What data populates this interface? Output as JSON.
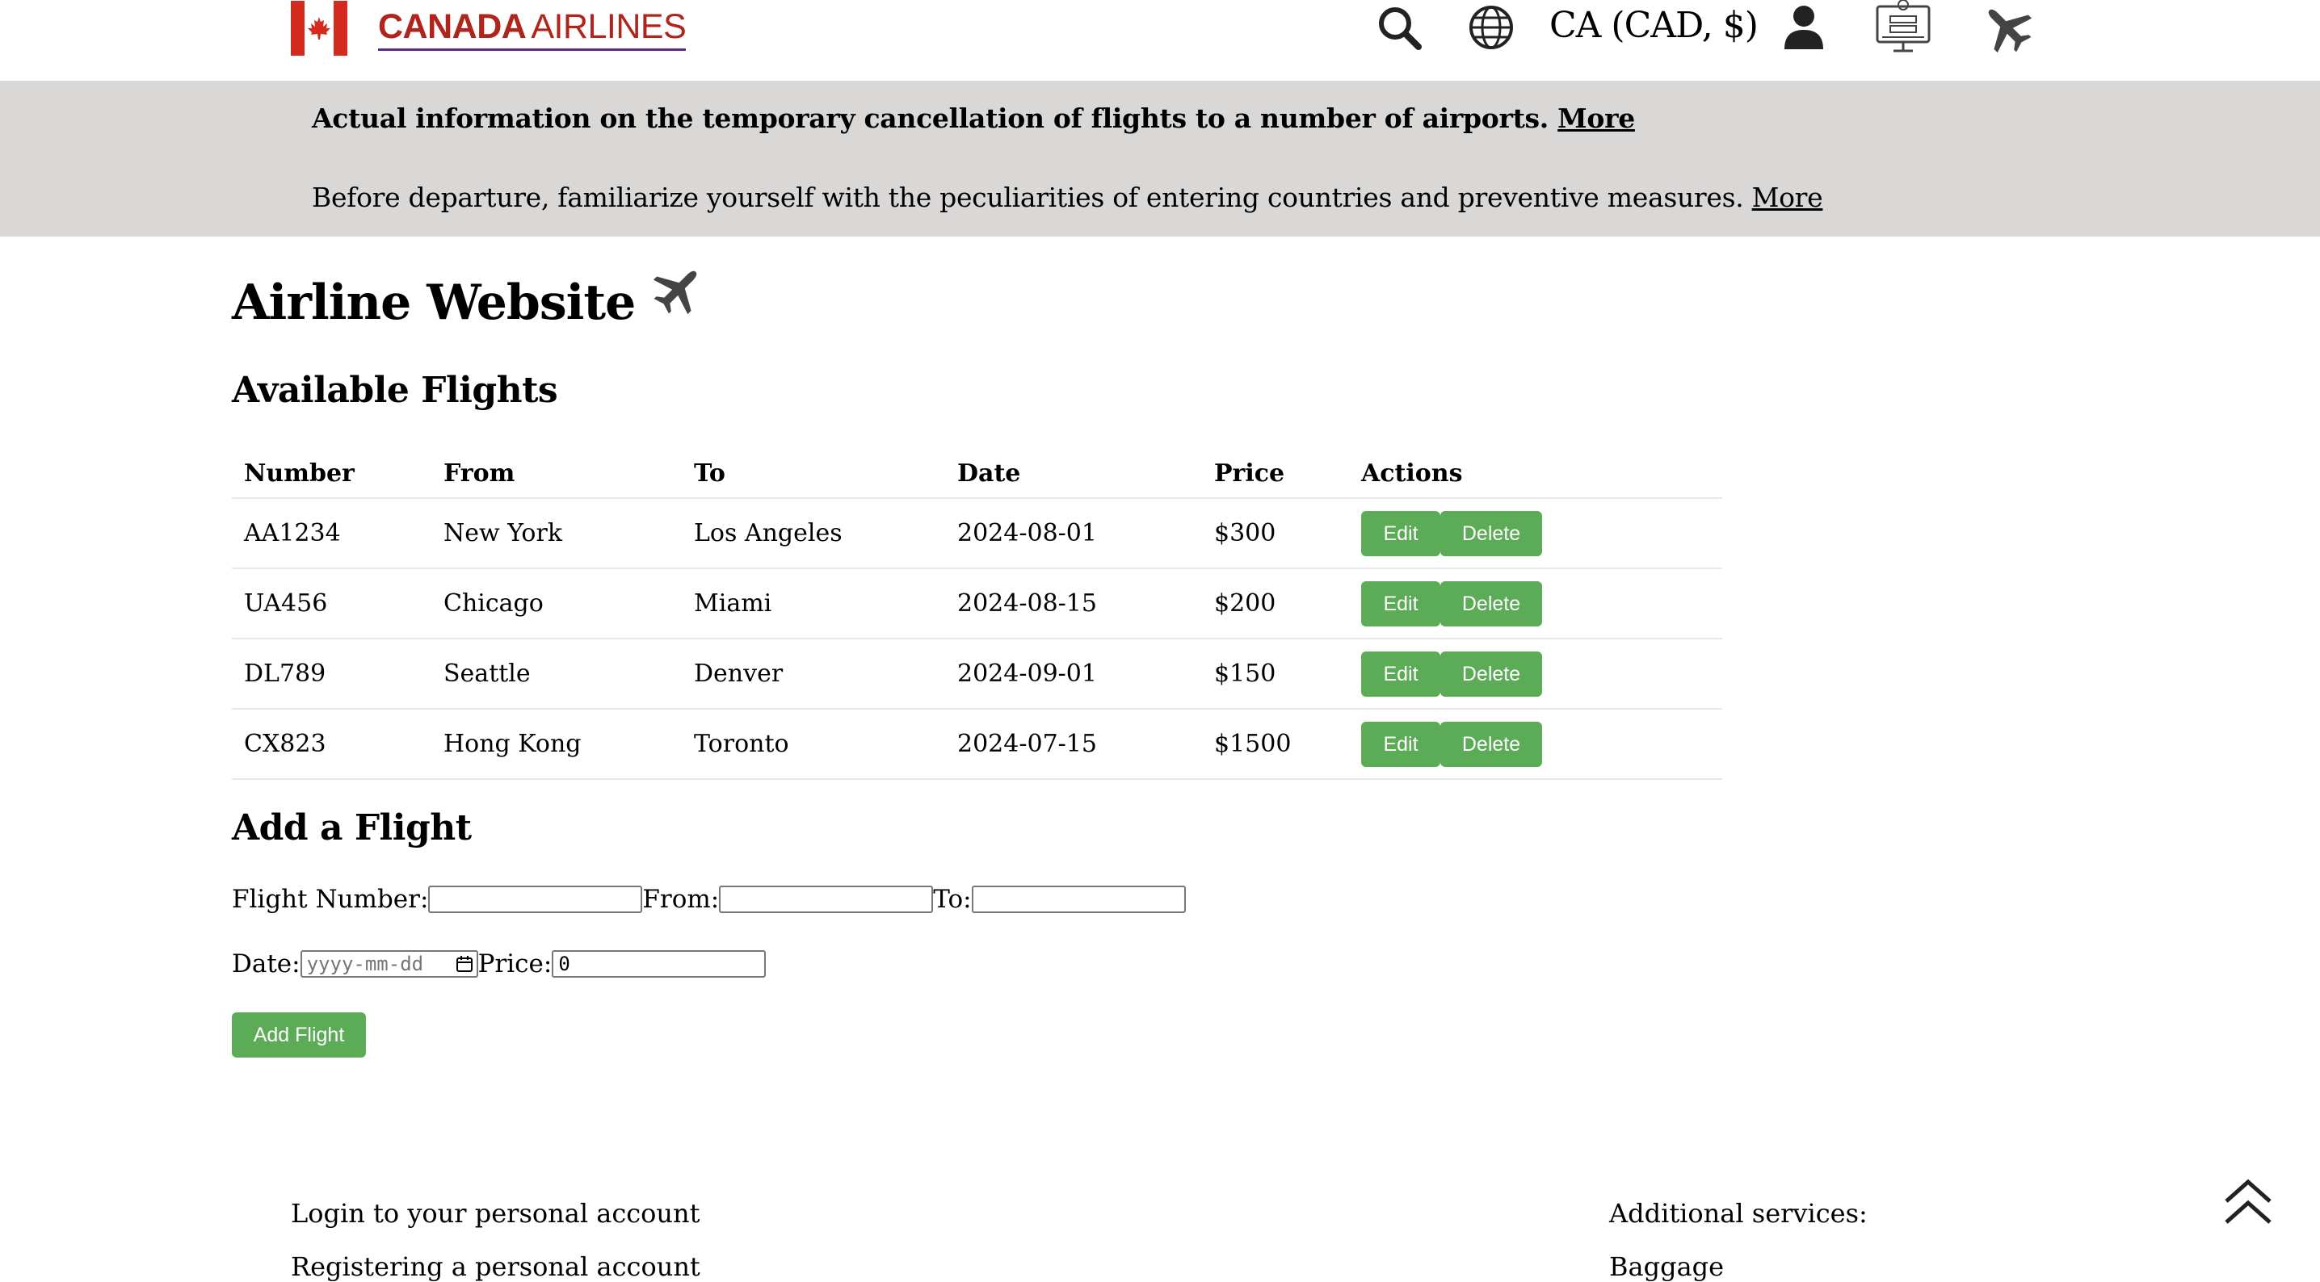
{
  "header": {
    "brand_bold": "CANADA",
    "brand_light": "AIRLINES",
    "currency": "CA (CAD, $)",
    "icons": [
      "search-icon",
      "globe-icon",
      "user-icon",
      "online-checkin-icon",
      "plane-icon"
    ]
  },
  "banner": {
    "line1_text": "Actual information on the temporary cancellation of flights to a number of airports. ",
    "line1_link": "More",
    "line2_text": "Before departure, familiarize yourself with the peculiarities of entering countries and preventive measures. ",
    "line2_link": "More"
  },
  "main": {
    "title": "Airline Website",
    "subtitle": "Available Flights"
  },
  "table": {
    "headers": [
      "Number",
      "From",
      "To",
      "Date",
      "Price",
      "Actions"
    ],
    "rows": [
      {
        "number": "AA1234",
        "from": "New York",
        "to": "Los Angeles",
        "date": "2024-08-01",
        "price": "$300"
      },
      {
        "number": "UA456",
        "from": "Chicago",
        "to": "Miami",
        "date": "2024-08-15",
        "price": "$200"
      },
      {
        "number": "DL789",
        "from": "Seattle",
        "to": "Denver",
        "date": "2024-09-01",
        "price": "$150"
      },
      {
        "number": "CX823",
        "from": "Hong Kong",
        "to": "Toronto",
        "date": "2024-07-15",
        "price": "$1500"
      }
    ],
    "edit_label": "Edit",
    "delete_label": "Delete"
  },
  "form": {
    "title": "Add a Flight",
    "flight_number_label": "Flight Number:",
    "from_label": "From:",
    "to_label": "To:",
    "date_label": "Date:",
    "date_placeholder": "yyyy-mm-dd",
    "price_label": "Price:",
    "price_value": "0",
    "submit_label": "Add Flight"
  },
  "footer": {
    "left_1": "Login to your personal account",
    "left_2": "Registering a personal account",
    "right_1": "Additional services:",
    "right_2": "Baggage"
  },
  "colors": {
    "accent_green": "#5cab57",
    "brand_red": "#b0241c",
    "banner_bg": "#dad8d7"
  }
}
